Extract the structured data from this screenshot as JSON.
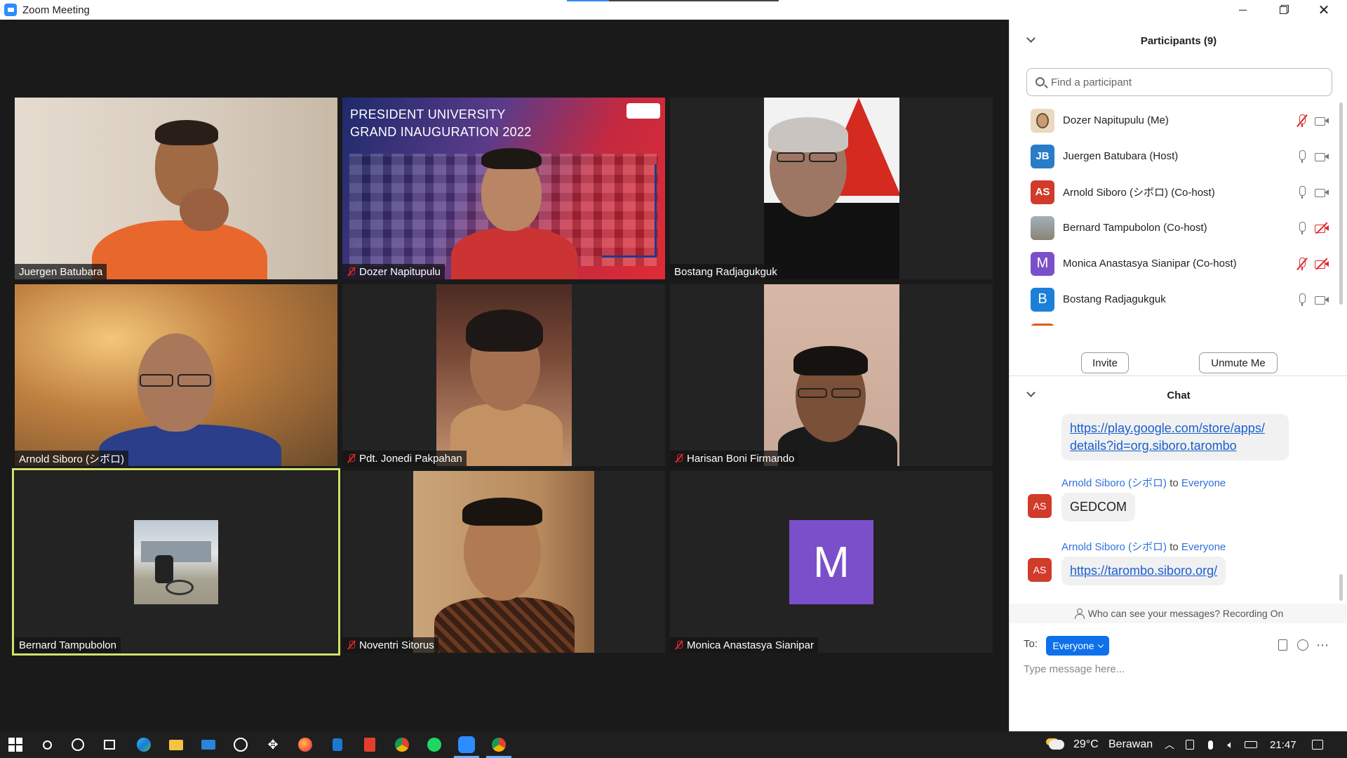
{
  "window": {
    "title": "Zoom Meeting",
    "minimize_icon": "minimize-icon",
    "restore_icon": "restore-icon",
    "close_icon": "close-icon"
  },
  "video_tiles": [
    {
      "name": "Juergen Batubara",
      "muted": false
    },
    {
      "name": "Dozer Napitupulu",
      "muted": true,
      "banner_line1": "PRESIDENT UNIVERSITY",
      "banner_line2": "GRAND INAUGURATION 2022"
    },
    {
      "name": "Bostang Radjagukguk",
      "muted": false
    },
    {
      "name": "Arnold Siboro (シボロ)",
      "muted": false
    },
    {
      "name": "Pdt. Jonedi Pakpahan",
      "muted": true
    },
    {
      "name": "Harisan Boni Firmando",
      "muted": true
    },
    {
      "name": "Bernard Tampubolon",
      "muted": false,
      "active_speaker": true
    },
    {
      "name": "Noventri Sitorus",
      "muted": true
    },
    {
      "name": "Monica Anastasya Sianipar",
      "muted": true,
      "avatar_letter": "M"
    }
  ],
  "participants_panel": {
    "title": "Participants (9)",
    "search_placeholder": "Find a participant",
    "items": [
      {
        "initials": "",
        "name": "Dozer Napitupulu (Me)",
        "avatar_color": "#e8d9c0",
        "mic_muted": true,
        "cam_off": false
      },
      {
        "initials": "JB",
        "name": "Juergen Batubara (Host)",
        "avatar_color": "#2a7cc7",
        "mic_muted": false,
        "cam_off": false
      },
      {
        "initials": "AS",
        "name": "Arnold Siboro (シボロ) (Co-host)",
        "avatar_color": "#d13b2c",
        "mic_muted": false,
        "cam_off": false
      },
      {
        "initials": "",
        "name": "Bernard Tampubolon (Co-host)",
        "avatar_color": "#8a8a7a",
        "mic_muted": false,
        "cam_off": true
      },
      {
        "initials": "M",
        "name": "Monica Anastasya Sianipar (Co-host)",
        "avatar_color": "#7b4fc9",
        "mic_muted": true,
        "cam_off": true
      },
      {
        "initials": "B",
        "name": "Bostang Radjagukguk",
        "avatar_color": "#1c7fd9",
        "mic_muted": false,
        "cam_off": false
      }
    ],
    "invite_label": "Invite",
    "unmute_label": "Unmute Me"
  },
  "chat_panel": {
    "title": "Chat",
    "messages": [
      {
        "text": "https://play.google.com/store/apps/details?id=org.siboro.tarombo",
        "line1": "https://play.google.com/store/apps/",
        "line2": "details?id=org.siboro.tarombo",
        "is_link": true
      },
      {
        "sender": "Arnold Siboro (シボロ)",
        "to_word": "to",
        "recipient": "Everyone",
        "avatar": "AS",
        "text": "GEDCOM",
        "is_link": false
      },
      {
        "sender": "Arnold Siboro (シボロ)",
        "to_word": "to",
        "recipient": "Everyone",
        "avatar": "AS",
        "text": "https://tarombo.siboro.org/",
        "is_link": true
      }
    ],
    "recording_note": "Who can see your messages? Recording On",
    "to_label": "To:",
    "to_value": "Everyone",
    "input_placeholder": "Type message here..."
  },
  "taskbar": {
    "weather": "29°C",
    "weather_desc": "Berawan",
    "time": "21:47"
  }
}
